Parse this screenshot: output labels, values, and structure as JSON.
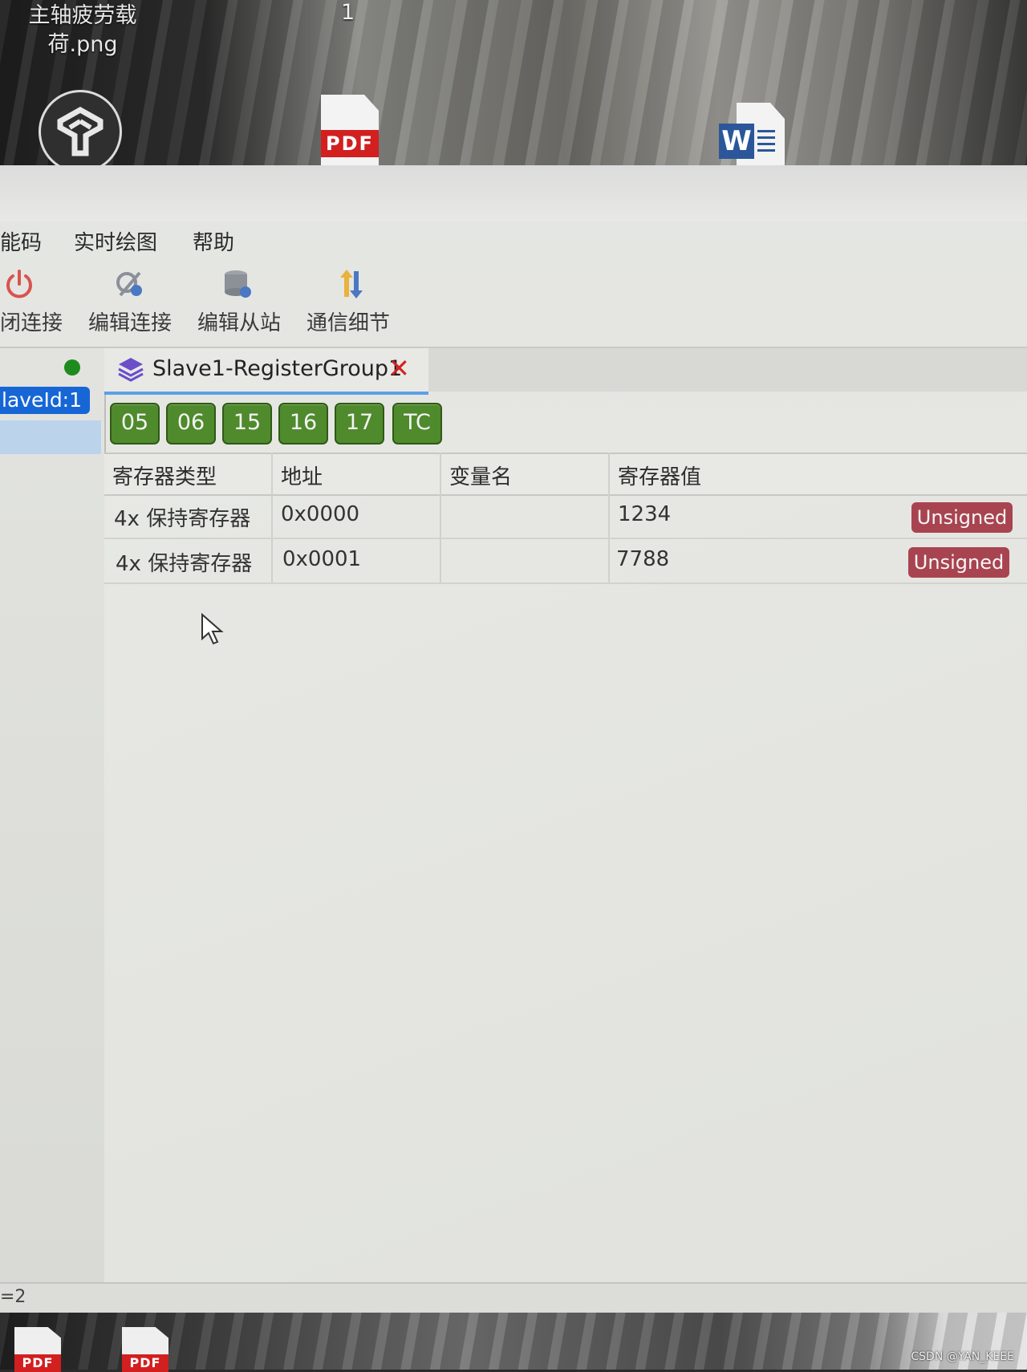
{
  "desktop": {
    "file_label_line1": "主轴疲劳载",
    "file_label_line2": "荷.png",
    "number_label": "1",
    "pdf_icon_label": "PDF",
    "word_icon_label": "W",
    "bottom_pdf_label": "PDF",
    "watermark": "CSDN @YAN_KEEE"
  },
  "menu": [
    "能码",
    "实时绘图",
    "帮助"
  ],
  "toolbar": [
    {
      "label": "闭连接",
      "icon": "power-icon"
    },
    {
      "label": "编辑连接",
      "icon": "edit-connection-icon"
    },
    {
      "label": "编辑从站",
      "icon": "edit-slave-icon"
    },
    {
      "label": "通信细节",
      "icon": "traffic-icon"
    }
  ],
  "tree": {
    "slave_label": "laveId:1",
    "status_color": "#1e8b1e"
  },
  "tab": {
    "title": "Slave1-RegisterGroup1",
    "close": "✕"
  },
  "function_codes": [
    "05",
    "06",
    "15",
    "16",
    "17",
    "TC"
  ],
  "table": {
    "columns": [
      "寄存器类型",
      "地址",
      "变量名",
      "寄存器值"
    ],
    "rows": [
      {
        "type": "4x 保持寄存器",
        "address": "0x0000",
        "name": "",
        "value": "1234",
        "format": "Unsigned"
      },
      {
        "type": "4x 保持寄存器",
        "address": "0x0001",
        "name": "",
        "value": "7788",
        "format": "Unsigned"
      }
    ]
  },
  "status_bar": {
    "text": "=2"
  },
  "colors": {
    "function_code_green": "#4f8a2c",
    "unsigned_badge": "#a84450",
    "selection_blue": "#1766d6",
    "close_red": "#d62020"
  }
}
